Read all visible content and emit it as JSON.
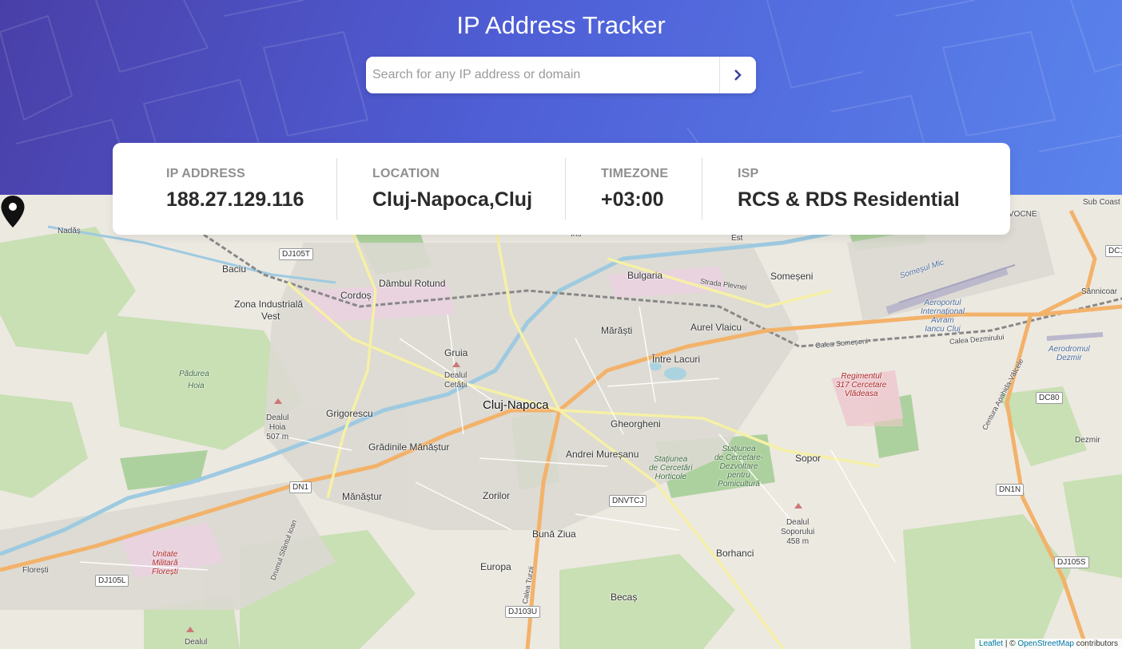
{
  "app": {
    "title": "IP Address Tracker"
  },
  "search": {
    "placeholder": "Search for any IP address or domain",
    "value": ""
  },
  "info": {
    "ip": {
      "label": "IP ADDRESS",
      "value": "188.27.129.116"
    },
    "location": {
      "label": "LOCATION",
      "value": "Cluj-Napoca,Cluj"
    },
    "timezone": {
      "label": "TIMEZONE",
      "value": "+03:00"
    },
    "isp": {
      "label": "ISP",
      "value": "RCS & RDS Residential"
    }
  },
  "map": {
    "labels": {
      "cluj": "Cluj-Napoca",
      "baciu": "Baciu",
      "dambul": "Dâmbul Rotund",
      "cordos": "Cordoș",
      "zona": "Zona Industrială",
      "vest": "Vest",
      "bulgaria": "Bulgaria",
      "someseni": "Someșeni",
      "marasti": "Mărăști",
      "aurel": "Aurel Vlaicu",
      "intre": "Între Lacuri",
      "gruia": "Gruia",
      "padurea1": "Pădurea",
      "padurea2": "Hoia",
      "grigorescu": "Grigorescu",
      "gradinile": "Grădinile Mănăștur",
      "gheorgheni": "Gheorgheni",
      "andrei": "Andrei Mureșanu",
      "manastur": "Mănăștur",
      "zorilor": "Zorilor",
      "buna": "Bună Ziua",
      "europa": "Europa",
      "becas": "Becaș",
      "borhanci": "Borhanci",
      "sopor": "Sopor",
      "dezmir": "Dezmir",
      "floresti": "Florești",
      "sannicoara": "Sânnicoar",
      "subcoasta": "Sub Coast",
      "est": "Est",
      "iris": "Iris",
      "dealul_hoia1": "Dealul",
      "dealul_hoia2": "Hoia",
      "dealul_hoia3": "507 m",
      "dealul_sop1": "Dealul",
      "dealul_sop2": "Soporului",
      "dealul_sop3": "458 m",
      "dealul_cet1": "Dealul",
      "dealul_cet2": "Cetății",
      "dealul_bottom": "Dealul",
      "aeroport1": "Aeroportul",
      "aeroport2": "Internațional",
      "aeroport3": "Avram",
      "aeroport4": "Iancu Cluj",
      "aerodrom1": "Aerodromul",
      "aerodrom2": "Dezmir",
      "regiment1": "Regimentul",
      "regiment2": "317 Cercetare",
      "regiment3": "Vlădeasa",
      "unitate1": "Unitate",
      "unitate2": "Militară",
      "unitate3": "Florești",
      "statiunea_a1": "Stațiunea",
      "statiunea_a2": "de Cercetări",
      "statiunea_a3": "Horticole",
      "statiunea_b1": "Stațiunea",
      "statiunea_b2": "de Cercetare-",
      "statiunea_b3": "Dezvoltare",
      "statiunea_b4": "pentru",
      "statiunea_b5": "Pomicultură",
      "somesul_mic": "Someșul Mic",
      "strada_plevnei": "Strada Plevnei",
      "calea_someseni": "Calea Someșeni",
      "calea_dezmirului": "Calea Dezmirului",
      "centura": "Centura Apahida-Vâlcele",
      "calea_turzii": "Calea Turzii",
      "drumul_sf": "Drumul Sfântul Ioan",
      "nadas": "Nadăș",
      "vocne": "VOCNE"
    },
    "shields": {
      "dj105t": "DJ105T",
      "dn1": "DN1",
      "dj105l": "DJ105L",
      "dnvtcj": "DNVTCJ",
      "dj103u": "DJ103U",
      "dc80": "DC80",
      "dn1n": "DN1N",
      "dj105s": "DJ105S",
      "dc1": "DC1"
    }
  },
  "attribution": {
    "leaflet": "Leaflet",
    "sep": " | © ",
    "osm": "OpenStreetMap",
    "rest": " contributors"
  }
}
